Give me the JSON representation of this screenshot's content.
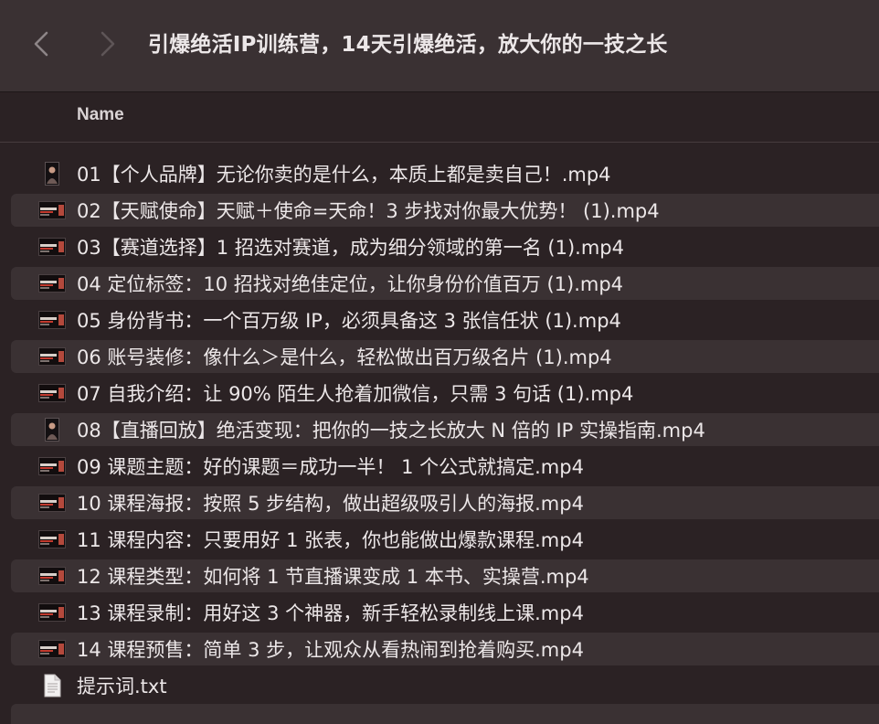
{
  "window": {
    "title": "引爆绝活IP训练营，14天引爆绝活，放大你的一技之长"
  },
  "column_header": {
    "name_label": "Name"
  },
  "colors": {
    "background": "#2b2224",
    "titlebar": "#3a3133",
    "alt_row": "#3a3133",
    "text": "#ece7e8"
  },
  "files": [
    {
      "name": "01【个人品牌】无论你卖的是什么，本质上都是卖自己！.mp4",
      "icon": "portrait-video-thumbnail-icon"
    },
    {
      "name": "02【天赋使命】天赋＋使命=天命！3 步找对你最大优势！ (1).mp4",
      "icon": "video-thumbnail-icon"
    },
    {
      "name": "03【赛道选择】1 招选对赛道，成为细分领域的第一名 (1).mp4",
      "icon": "video-thumbnail-icon"
    },
    {
      "name": "04 定位标签：10 招找对绝佳定位，让你身份价值百万 (1).mp4",
      "icon": "video-thumbnail-icon"
    },
    {
      "name": "05 身份背书：一个百万级 IP，必须具备这 3 张信任状 (1).mp4",
      "icon": "video-thumbnail-icon"
    },
    {
      "name": "06 账号装修：像什么＞是什么，轻松做出百万级名片 (1).mp4",
      "icon": "video-thumbnail-icon"
    },
    {
      "name": "07 自我介绍：让 90% 陌生人抢着加微信，只需 3 句话 (1).mp4",
      "icon": "video-thumbnail-icon"
    },
    {
      "name": "08【直播回放】绝活变现：把你的一技之长放大 N 倍的 IP 实操指南.mp4",
      "icon": "portrait-video-thumbnail-icon"
    },
    {
      "name": "09 课题主题：好的课题＝成功一半！ 1 个公式就搞定.mp4",
      "icon": "video-thumbnail-icon"
    },
    {
      "name": "10 课程海报：按照 5 步结构，做出超级吸引人的海报.mp4",
      "icon": "video-thumbnail-icon"
    },
    {
      "name": "11 课程内容：只要用好 1 张表，你也能做出爆款课程.mp4",
      "icon": "video-thumbnail-icon"
    },
    {
      "name": "12 课程类型：如何将 1 节直播课变成 1 本书、实操营.mp4",
      "icon": "video-thumbnail-icon"
    },
    {
      "name": "13 课程录制：用好这 3 个神器，新手轻松录制线上课.mp4",
      "icon": "video-thumbnail-icon"
    },
    {
      "name": "14 课程预售：简单 3 步，让观众从看热闹到抢着购买.mp4",
      "icon": "video-thumbnail-icon"
    },
    {
      "name": "提示词.txt",
      "icon": "text-document-icon"
    }
  ]
}
